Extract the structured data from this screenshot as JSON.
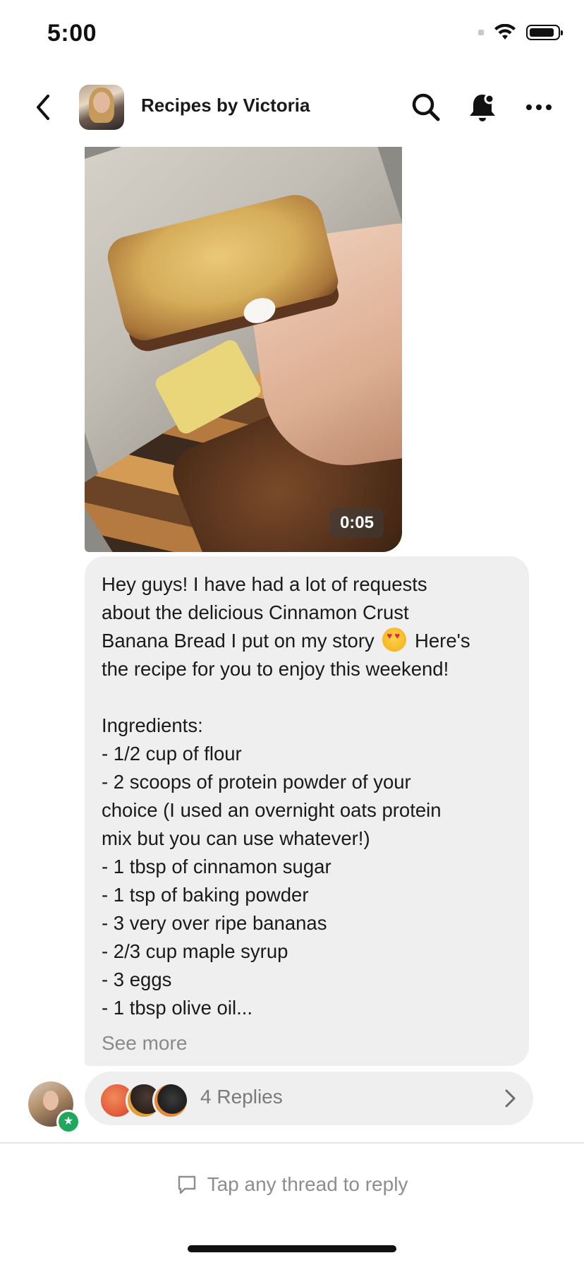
{
  "status_bar": {
    "time": "5:00"
  },
  "header": {
    "back_icon": "chevron-left-icon",
    "channel_name": "Recipes by Victoria",
    "search_icon": "search-icon",
    "bell_icon": "bell-icon",
    "more_icon": "more-horizontal-icon"
  },
  "post": {
    "video_duration": "0:05",
    "message_lines": [
      "Hey guys! I have had a lot of requests",
      "about the delicious Cinnamon Crust",
      "Banana Bread I put on my story",
      "the recipe for you to enjoy this weekend!",
      "",
      "Ingredients:",
      "- 1/2 cup of flour",
      "- 2 scoops of protein powder of your",
      "choice (I used an overnight oats protein",
      "mix but you can use whatever!)",
      "- 1 tbsp of cinnamon sugar",
      "- 1 tsp of baking powder",
      "- 3 very over ripe bananas",
      "- 2/3 cup maple syrup",
      "- 3 eggs",
      "- 1 tbsp olive oil..."
    ],
    "line3_suffix": "Here's",
    "emoji": "heart-eyes-emoji",
    "see_more_label": "See more"
  },
  "replies": {
    "label": "4 Replies",
    "chevron_icon": "chevron-right-icon"
  },
  "composer": {
    "hint": "Tap any thread to reply",
    "hint_icon": "chat-bubble-icon"
  },
  "colors": {
    "bubble_bg": "#efefef",
    "admin_badge": "#1fa85b",
    "muted_text": "#8a8a8a"
  }
}
